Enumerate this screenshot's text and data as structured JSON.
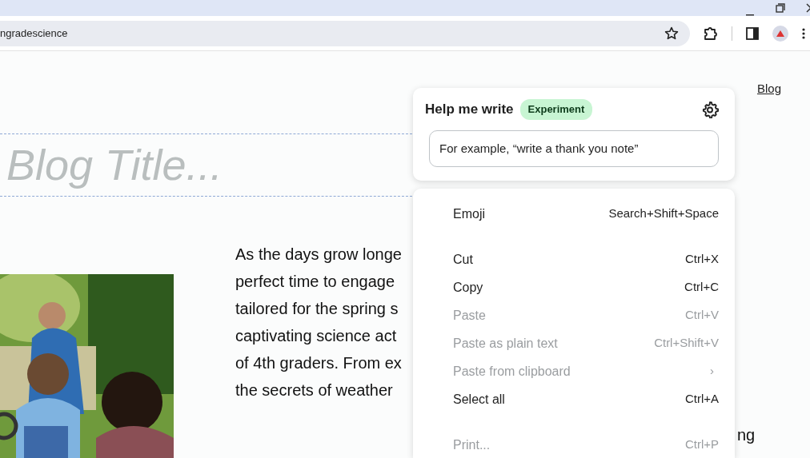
{
  "browser": {
    "url": "ngradescience"
  },
  "nav": [
    {
      "label": "Blog",
      "selected": true
    }
  ],
  "blog_title": {
    "placeholder": "Blog Title..."
  },
  "paragraph": [
    "As the days grow longe",
    "perfect time to engage",
    "tailored for the spring s",
    "captivating science act",
    "of 4th graders. From ex",
    "the secrets of weather"
  ],
  "paragraph_right": "ng",
  "help_me_write": {
    "title": "Help me write",
    "badge": "Experiment",
    "placeholder": "For example, “write a thank you note”"
  },
  "context_menu": [
    {
      "kind": "item",
      "label": "Emoji",
      "shortcut": "Search+Shift+Space",
      "disabled": false
    },
    {
      "kind": "separator"
    },
    {
      "kind": "item",
      "label": "Cut",
      "shortcut": "Ctrl+X",
      "disabled": false
    },
    {
      "kind": "item",
      "label": "Copy",
      "shortcut": "Ctrl+C",
      "disabled": false
    },
    {
      "kind": "item",
      "label": "Paste",
      "shortcut": "Ctrl+V",
      "disabled": true
    },
    {
      "kind": "item",
      "label": "Paste as plain text",
      "shortcut": "Ctrl+Shift+V",
      "disabled": true
    },
    {
      "kind": "submenu",
      "label": "Paste from clipboard",
      "shortcut": "›",
      "disabled": true
    },
    {
      "kind": "item",
      "label": "Select all",
      "shortcut": "Ctrl+A",
      "disabled": false
    },
    {
      "kind": "separator"
    },
    {
      "kind": "item",
      "label": "Print...",
      "shortcut": "Ctrl+P",
      "disabled": true
    }
  ]
}
